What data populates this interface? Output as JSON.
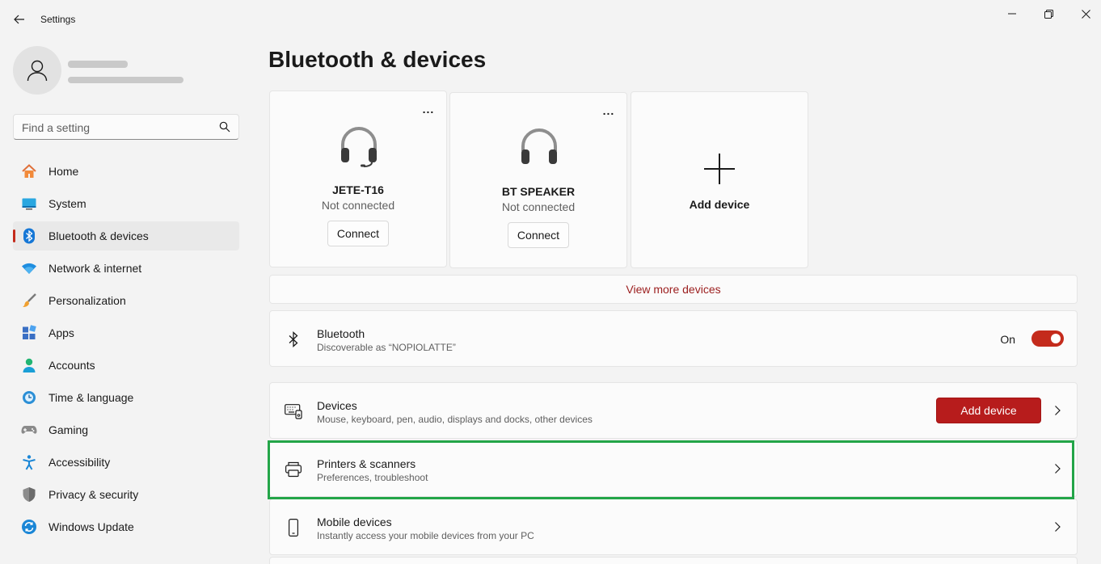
{
  "window": {
    "title": "Settings"
  },
  "search": {
    "placeholder": "Find a setting"
  },
  "sidebar": {
    "items": [
      {
        "label": "Home",
        "icon": "home-icon"
      },
      {
        "label": "System",
        "icon": "system-icon"
      },
      {
        "label": "Bluetooth & devices",
        "icon": "bluetooth-icon",
        "active": true
      },
      {
        "label": "Network & internet",
        "icon": "wifi-icon"
      },
      {
        "label": "Personalization",
        "icon": "brush-icon"
      },
      {
        "label": "Apps",
        "icon": "apps-icon"
      },
      {
        "label": "Accounts",
        "icon": "accounts-icon"
      },
      {
        "label": "Time & language",
        "icon": "globe-clock-icon"
      },
      {
        "label": "Gaming",
        "icon": "gamepad-icon"
      },
      {
        "label": "Accessibility",
        "icon": "accessibility-icon"
      },
      {
        "label": "Privacy & security",
        "icon": "shield-icon"
      },
      {
        "label": "Windows Update",
        "icon": "update-icon"
      }
    ]
  },
  "main": {
    "title": "Bluetooth & devices",
    "devices": [
      {
        "name": "JETE-T16",
        "status": "Not connected",
        "action": "Connect",
        "more": "..."
      },
      {
        "name": "BT SPEAKER",
        "status": "Not connected",
        "action": "Connect",
        "more": "..."
      }
    ],
    "add_card": {
      "label": "Add device"
    },
    "view_more": "View more devices",
    "bluetooth": {
      "title": "Bluetooth",
      "subtitle": "Discoverable as “NOPIOLATTE”",
      "state_label": "On",
      "enabled": true
    },
    "devices_row": {
      "title": "Devices",
      "subtitle": "Mouse, keyboard, pen, audio, displays and docks, other devices",
      "button": "Add device"
    },
    "printers_row": {
      "title": "Printers & scanners",
      "subtitle": "Preferences, troubleshoot"
    },
    "mobile_row": {
      "title": "Mobile devices",
      "subtitle": "Instantly access your mobile devices from your PC"
    }
  },
  "colors": {
    "accent": "#c42b1c",
    "highlight": "#23a548",
    "link": "#9b1d1d"
  }
}
